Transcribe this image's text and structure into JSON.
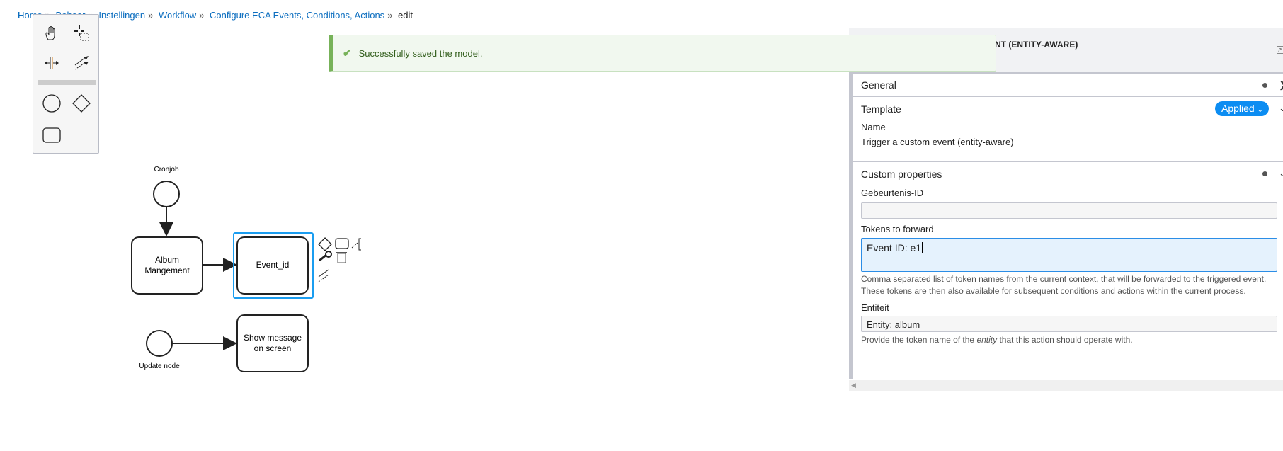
{
  "breadcrumb": {
    "items": [
      "Home",
      "Beheer",
      "Instellingen",
      "Workflow",
      "Configure ECA Events, Conditions, Actions"
    ],
    "visible_items": [
      "Ho",
      "Instellingen",
      "Workflow",
      "Configure ECA Events, Conditions, Actions"
    ],
    "current": "edit",
    "separator": "»"
  },
  "message": {
    "text": "Successfully saved the model.",
    "icon": "check-icon",
    "color": "#77b259"
  },
  "palette": {
    "tools": [
      "hand-tool-icon",
      "lasso-tool-icon",
      "space-tool-icon",
      "global-connect-tool-icon",
      "start-event-icon",
      "gateway-icon",
      "task-icon"
    ]
  },
  "diagram": {
    "start_events": [
      {
        "label": "Cronjob"
      },
      {
        "label": "Update node"
      }
    ],
    "tasks": [
      {
        "label_lines": [
          "Album",
          "Mangement"
        ]
      },
      {
        "label_lines": [
          "Event_id"
        ],
        "selected": true
      },
      {
        "label_lines": [
          "Show message",
          "on screen"
        ]
      }
    ]
  },
  "panel": {
    "header_title": "NT (ENTITY-AWARE)",
    "groups": {
      "general": "General",
      "template": "Template",
      "custom": "Custom properties"
    },
    "applied_label": "Applied",
    "name_label": "Name",
    "name_value": "Trigger a custom event (entity-aware)",
    "event_id_label": "Gebeurtenis-ID",
    "event_id_value": "",
    "tokens_label": "Tokens to forward",
    "tokens_value": "Event ID: e1",
    "tokens_desc": "Comma separated list of token names from the current context, that will be forwarded to the triggered event. These tokens are then also available for subsequent conditions and actions within the current process.",
    "entity_label": "Entiteit",
    "entity_value": "Entity: album",
    "entity_desc_pre": "Provide the token name of the ",
    "entity_desc_em": "entity",
    "entity_desc_post": " that this action should operate with."
  },
  "colors": {
    "accent": "#0c8df2",
    "selection": "#1a9df0"
  }
}
